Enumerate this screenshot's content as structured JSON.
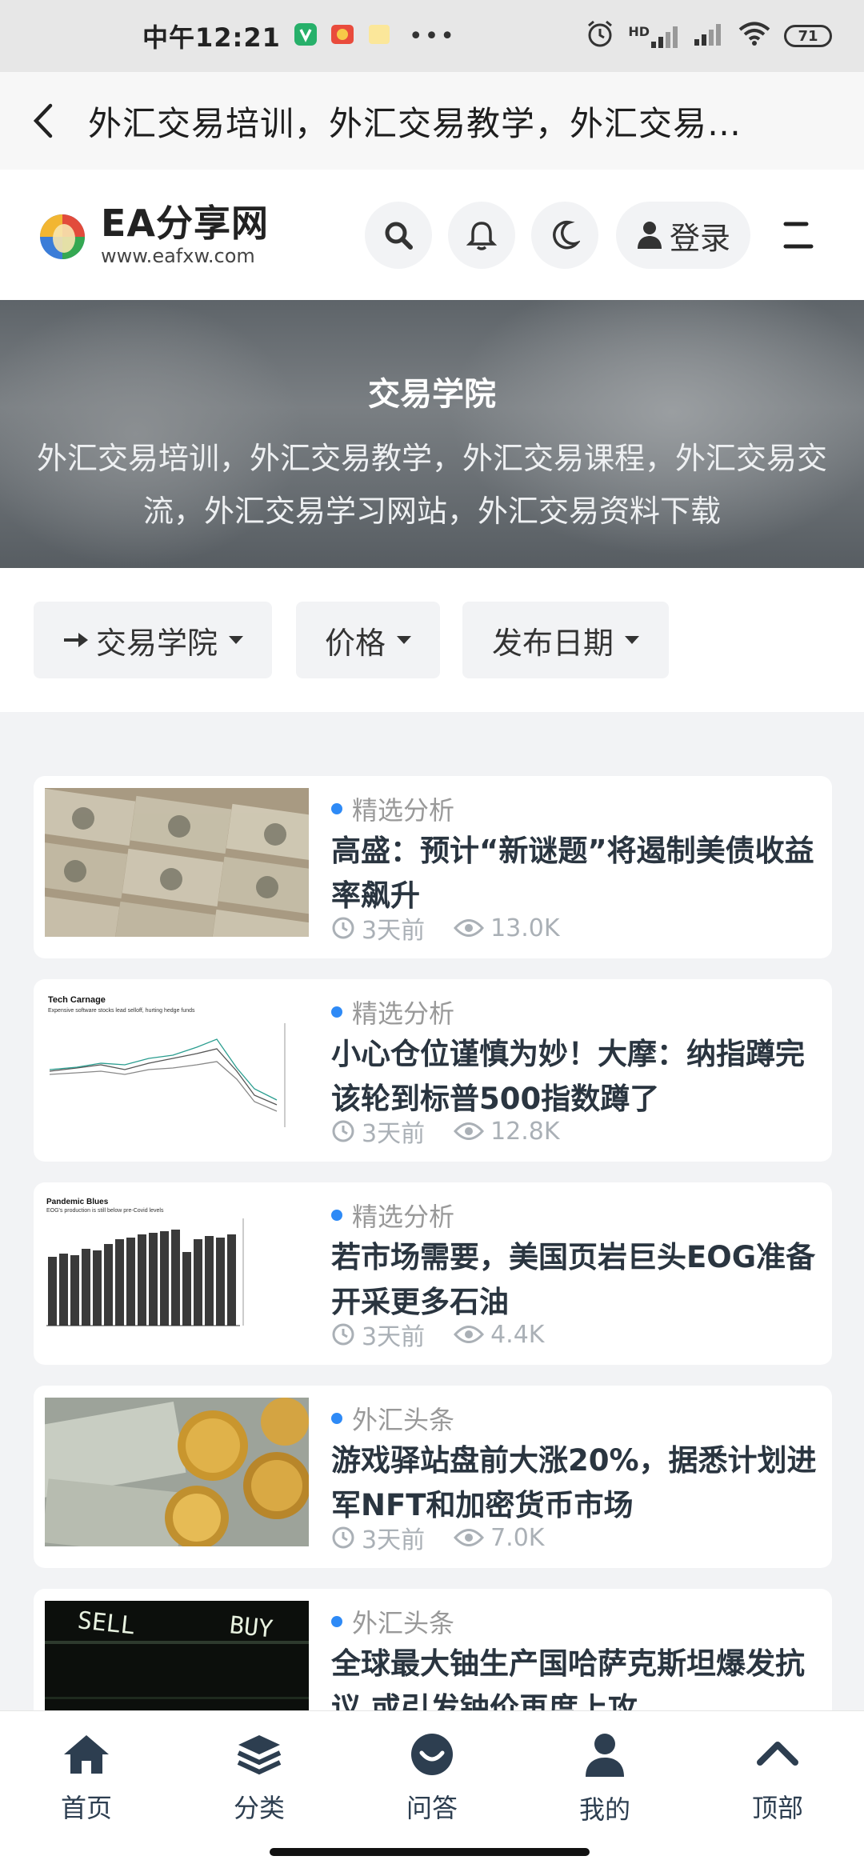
{
  "status_bar": {
    "time": "中午12:21",
    "battery": "71",
    "network": "HD"
  },
  "titlebar": {
    "title": "外汇交易培训，外汇交易教学，外汇交易…"
  },
  "header": {
    "brand": "EA分享网",
    "url": "www.eafxw.com",
    "login_label": "登录"
  },
  "hero": {
    "title": "交易学院",
    "description": "外汇交易培训，外汇交易教学，外汇交易课程，外汇交易交流，外汇交易学习网站，外汇交易资料下载"
  },
  "filters": [
    {
      "label": "交易学院"
    },
    {
      "label": "价格"
    },
    {
      "label": "发布日期"
    }
  ],
  "articles": [
    {
      "category": "精选分析",
      "title": "高盛：预计“新谜题”将遏制美债收益率飙升",
      "time": "3天前",
      "views": "13.0K"
    },
    {
      "category": "精选分析",
      "title": "小心仓位谨慎为妙！大摩：纳指蹲完该轮到标普500指数蹲了",
      "time": "3天前",
      "views": "12.8K"
    },
    {
      "category": "精选分析",
      "title": "若市场需要，美国页岩巨头EOG准备开采更多石油",
      "time": "3天前",
      "views": "4.4K"
    },
    {
      "category": "外汇头条",
      "title": "游戏驿站盘前大涨20%，据悉计划进军NFT和加密货币市场",
      "time": "3天前",
      "views": "7.0K"
    },
    {
      "category": "外汇头条",
      "title": "全球最大铀生产国哈萨克斯坦爆发抗议 或引发铀价再度上攻",
      "time": "",
      "views": ""
    }
  ],
  "thumb_text": {
    "chart1_title": "Tech Carnage",
    "chart1_subtitle": "Expensive software stocks lead selloff, hurting hedge funds",
    "chart2_title": "Pandemic Blues",
    "chart2_subtitle": "EOG's production is still below pre-Covid levels",
    "sell": "SELL",
    "buy": "BUY"
  },
  "tabbar": [
    {
      "label": "首页"
    },
    {
      "label": "分类"
    },
    {
      "label": "问答"
    },
    {
      "label": "我的"
    },
    {
      "label": "顶部"
    }
  ],
  "colors": {
    "accent": "#2e8af6",
    "title_text": "#2a3540",
    "tab_icon": "#2d3e50"
  }
}
